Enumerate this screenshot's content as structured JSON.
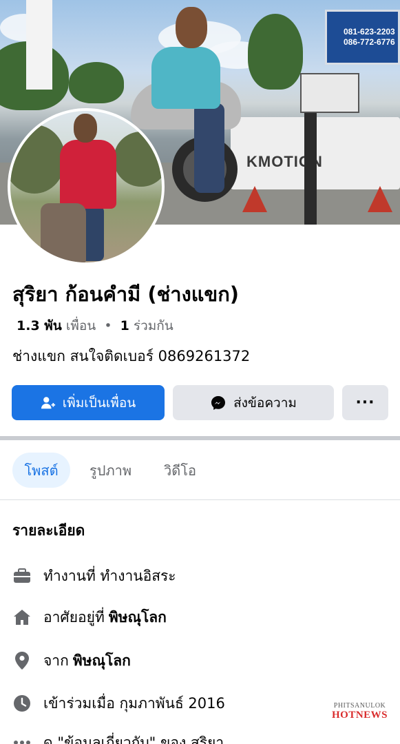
{
  "cover": {
    "banner_text": "KMOTION",
    "billboard_lines": [
      "081-623-2203",
      "086-772-6776"
    ]
  },
  "profile": {
    "name": "สุริยา ก้อนคำมี (ช่างแขก)",
    "friends_count": "1.3 พัน",
    "friends_label": "เพื่อน",
    "separator": "•",
    "mutual_count": "1",
    "mutual_label": "ร่วมกัน",
    "bio": "ช่างแขก  สนใจติดเบอร์ 0869261372"
  },
  "actions": {
    "add_friend_label": "เพิ่มเป็นเพื่อน",
    "message_label": "ส่งข้อความ",
    "more_label": "···"
  },
  "tabs": [
    {
      "label": "โพสต์",
      "active": true
    },
    {
      "label": "รูปภาพ",
      "active": false
    },
    {
      "label": "วิดีโอ",
      "active": false
    }
  ],
  "details": {
    "title": "รายละเอียด",
    "items": [
      {
        "icon": "briefcase-icon",
        "text": "ทำงานที่ ทำงานอิสระ",
        "bold": ""
      },
      {
        "icon": "home-icon",
        "text": "อาศัยอยู่ที่",
        "bold": "พิษณุโลก"
      },
      {
        "icon": "location-pin-icon",
        "text": "จาก",
        "bold": "พิษณุโลก"
      },
      {
        "icon": "clock-icon",
        "text": "เข้าร่วมเมื่อ กุมภาพันธ์ 2016",
        "bold": ""
      },
      {
        "icon": "more-icon",
        "text": "ดู \"ข้อมูลเกี่ยวกับ\" ของ สุริยา",
        "bold": ""
      }
    ]
  },
  "watermark": {
    "line1": "PHITSANULOK",
    "line2": "HOTNEWS"
  },
  "colors": {
    "primary": "#1b74e4",
    "secondary_button": "#e4e6eb",
    "active_tab_bg": "#e7f3ff",
    "icon_gray": "#65676b"
  }
}
